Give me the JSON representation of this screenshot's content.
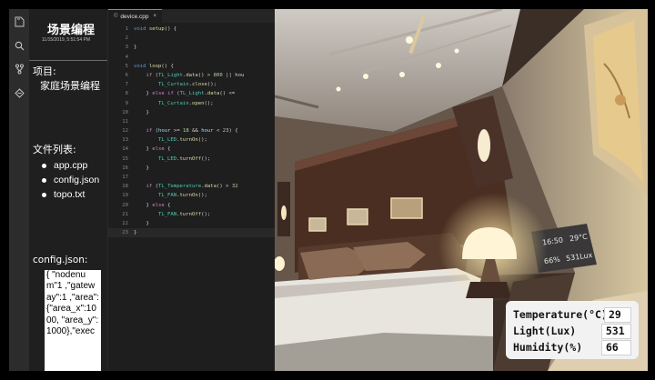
{
  "sidebar": {
    "title": "场景编程",
    "date": "11/15/2019, 5:51:54 PM",
    "project_label": "项目:",
    "project_name": "家庭场景编程",
    "files_label": "文件列表:",
    "files": [
      "app.cpp",
      "config.json",
      "topo.txt"
    ],
    "config_label": "config.json:",
    "config_content": "{ \"nodenum\"1 ,\"gateway\":1 ,\"area\": {\"area_x\":10 00, \"area_y\": 1000},\"exec"
  },
  "activity_icons": [
    "files-icon",
    "search-icon",
    "source-control-icon",
    "extensions-icon"
  ],
  "editor": {
    "tab_label": "device.cpp",
    "tab_close": "×",
    "lines": [
      {
        "n": "1",
        "t": "void setup() {"
      },
      {
        "n": "2",
        "t": ""
      },
      {
        "n": "3",
        "t": "}"
      },
      {
        "n": "4",
        "t": ""
      },
      {
        "n": "5",
        "t": "void loop() {"
      },
      {
        "n": "6",
        "t": "    if (TL_Light.data() > 800 || hou"
      },
      {
        "n": "7",
        "t": "        TL_Curtain.close();"
      },
      {
        "n": "8",
        "t": "    } else if (TL_Light.data() <="
      },
      {
        "n": "9",
        "t": "        TL_Curtain.open();"
      },
      {
        "n": "10",
        "t": "    }"
      },
      {
        "n": "11",
        "t": ""
      },
      {
        "n": "12",
        "t": "    if (hour >= 18 && hour < 23) {"
      },
      {
        "n": "13",
        "t": "        TL_LED.turnOn();"
      },
      {
        "n": "14",
        "t": "    } else {"
      },
      {
        "n": "15",
        "t": "        TL_LED.turnOff();"
      },
      {
        "n": "16",
        "t": "    }"
      },
      {
        "n": "17",
        "t": ""
      },
      {
        "n": "18",
        "t": "    if (TL_Temperature.data() > 32"
      },
      {
        "n": "19",
        "t": "        TL_FAN.turnOn();"
      },
      {
        "n": "20",
        "t": "    } else {"
      },
      {
        "n": "21",
        "t": "        TL_FAN.turnOff();"
      },
      {
        "n": "22",
        "t": "    }"
      },
      {
        "n": "23",
        "t": "}"
      }
    ]
  },
  "wall_panel": {
    "time": "16:50",
    "temp": "29°C",
    "humidity": "66%",
    "lux": "531Lux"
  },
  "sensors": [
    {
      "label": "Temperature(°C)",
      "value": "29"
    },
    {
      "label": "Light(Lux)",
      "value": "531"
    },
    {
      "label": "Humidity(%)",
      "value": "66"
    }
  ]
}
